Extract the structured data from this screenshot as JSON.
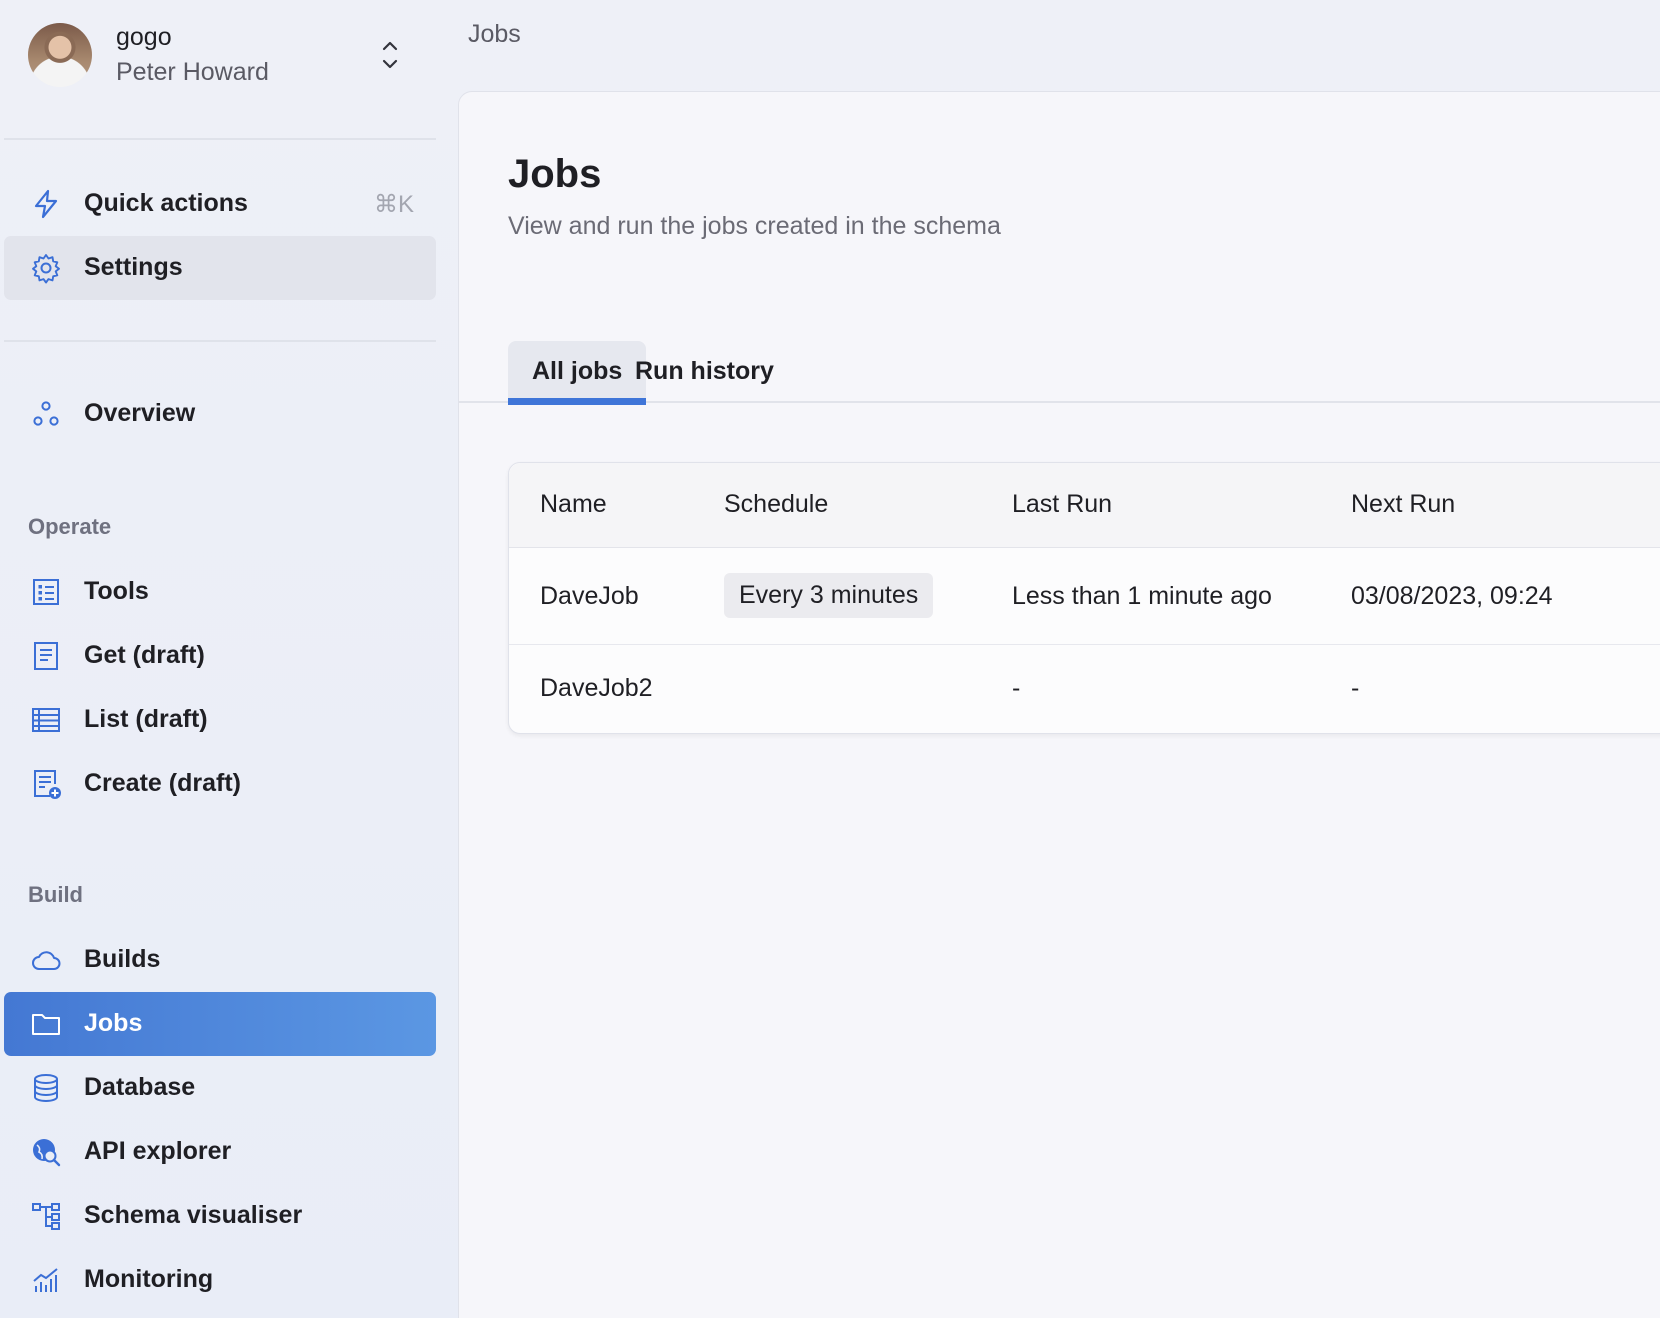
{
  "account": {
    "org": "gogo",
    "user": "Peter Howard"
  },
  "breadcrumb": "Jobs",
  "sidebar": {
    "quick_actions": {
      "label": "Quick actions",
      "shortcut": "⌘K"
    },
    "settings": {
      "label": "Settings"
    },
    "overview": {
      "label": "Overview"
    },
    "sections": {
      "operate": "Operate",
      "build": "Build"
    },
    "operate_items": [
      {
        "label": "Tools",
        "icon": "tools-icon"
      },
      {
        "label": "Get (draft)",
        "icon": "document-icon"
      },
      {
        "label": "List (draft)",
        "icon": "list-icon"
      },
      {
        "label": "Create (draft)",
        "icon": "create-document-icon"
      }
    ],
    "build_items": [
      {
        "label": "Builds",
        "icon": "cloud-icon"
      },
      {
        "label": "Jobs",
        "icon": "folder-icon",
        "active": true
      },
      {
        "label": "Database",
        "icon": "database-icon"
      },
      {
        "label": "API explorer",
        "icon": "globe-search-icon"
      },
      {
        "label": "Schema visualiser",
        "icon": "schema-icon"
      },
      {
        "label": "Monitoring",
        "icon": "chart-icon"
      }
    ]
  },
  "main": {
    "title": "Jobs",
    "subtitle": "View and run the jobs created in the schema",
    "tabs": [
      {
        "label": "All jobs",
        "selected": true
      },
      {
        "label": "Run history"
      }
    ],
    "table": {
      "headers": [
        "Name",
        "Schedule",
        "Last Run",
        "Next Run"
      ],
      "rows": [
        {
          "name": "DaveJob",
          "schedule": "Every 3 minutes",
          "last_run": "Less than 1 minute ago",
          "next_run": "03/08/2023, 09:24"
        },
        {
          "name": "DaveJob2",
          "schedule": "",
          "last_run": "-",
          "next_run": "-"
        }
      ]
    }
  },
  "colors": {
    "accent": "#3f75d8",
    "active_nav_start": "#4478d3",
    "active_nav_end": "#5b97e3",
    "icon_blue": "#3b6fd6"
  }
}
